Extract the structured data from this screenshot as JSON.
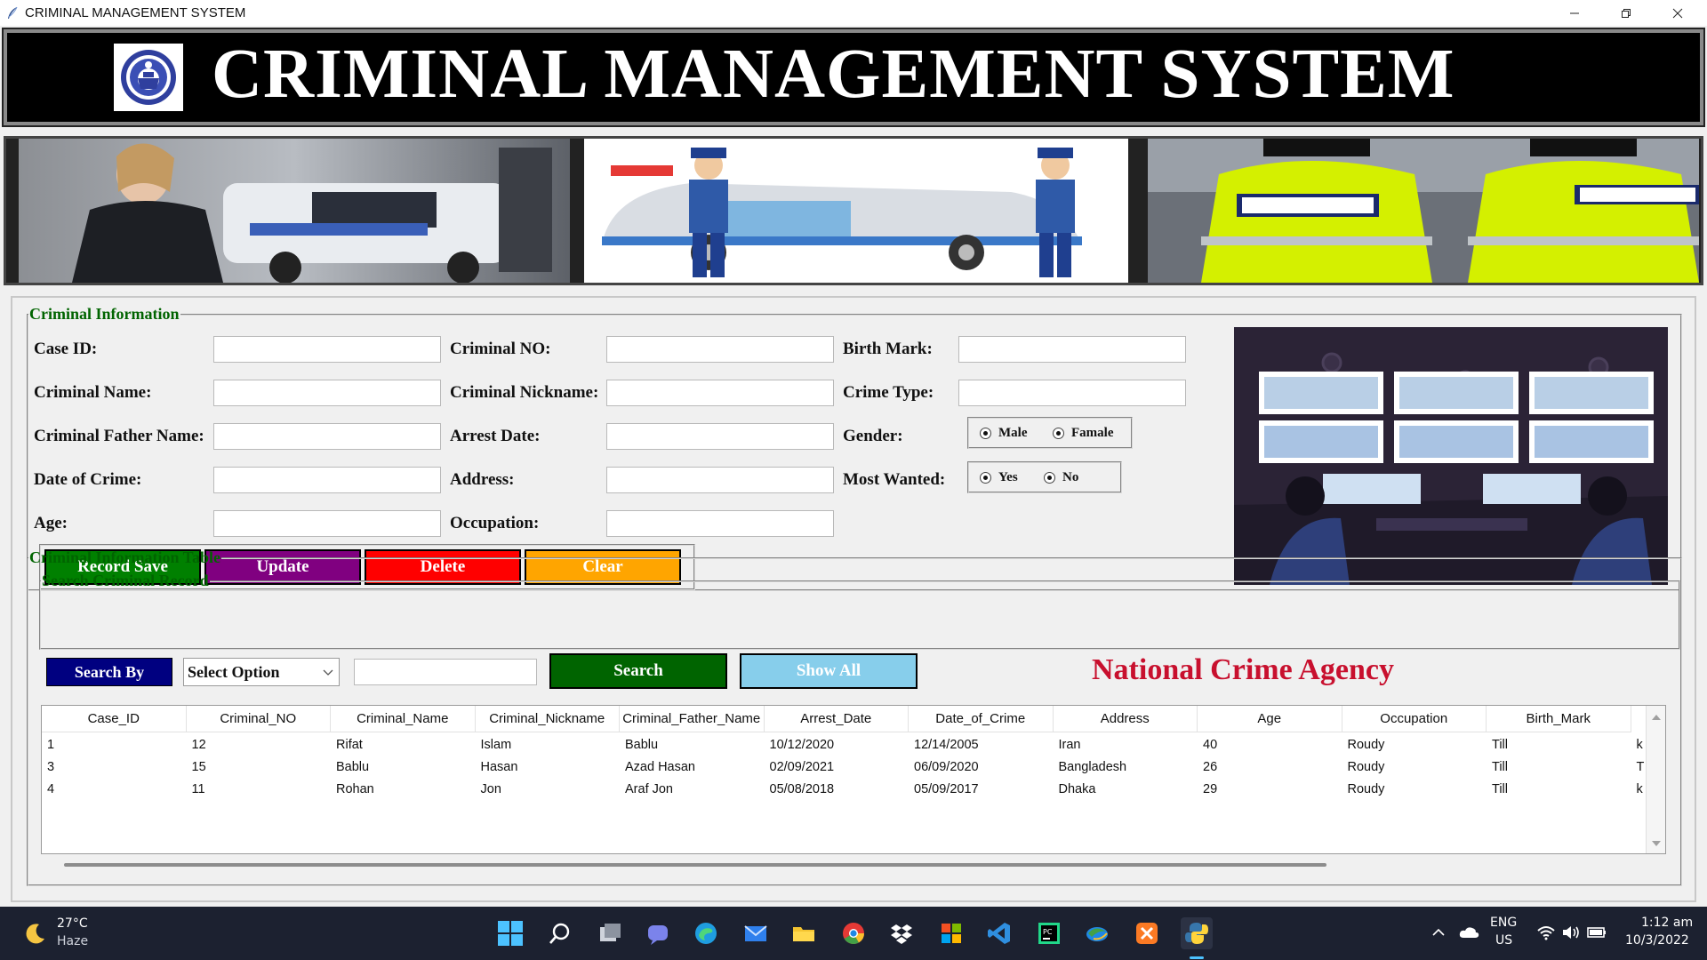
{
  "window": {
    "title": "CRIMINAL MANAGEMENT SYSTEM"
  },
  "header": {
    "title": "CRIMINAL MANAGEMENT SYSTEM"
  },
  "form": {
    "legend": "Criminal Information",
    "labels": {
      "case_id": "Case ID:",
      "criminal_no": "Criminal NO:",
      "birth_mark": "Birth Mark:",
      "criminal_name": "Criminal Name:",
      "criminal_nickname": "Criminal Nickname:",
      "crime_type": "Crime Type:",
      "father_name": "Criminal Father Name:",
      "arrest_date": "Arrest Date:",
      "gender": "Gender:",
      "date_of_crime": "Date of Crime:",
      "address": "Address:",
      "most_wanted": "Most Wanted:",
      "age": "Age:",
      "occupation": "Occupation:"
    },
    "values": {
      "case_id": "",
      "criminal_no": "",
      "birth_mark": "",
      "criminal_name": "",
      "criminal_nickname": "",
      "crime_type": "",
      "father_name": "",
      "arrest_date": "",
      "date_of_crime": "",
      "address": "",
      "age": "",
      "occupation": ""
    },
    "gender_options": [
      "Male",
      "Famale"
    ],
    "most_wanted_options": [
      "Yes",
      "No"
    ],
    "buttons": {
      "save": "Record Save",
      "update": "Update",
      "delete": "Delete",
      "clear": "Clear"
    }
  },
  "table_section": {
    "legend": "Criminal Information Table",
    "search_legend": "Search Criminal Record",
    "search_by": "Search By",
    "select_value": "Select Option",
    "search_text": "",
    "search_button": "Search",
    "show_all_button": "Show All",
    "agency": "National Crime Agency"
  },
  "table": {
    "columns": [
      "Case_ID",
      "Criminal_NO",
      "Criminal_Name",
      "Criminal_Nickname",
      "Criminal_Father_Name",
      "Arrest_Date",
      "Date_of_Crime",
      "Address",
      "Age",
      "Occupation",
      "Birth_Mark"
    ],
    "rows": [
      [
        "1",
        "12",
        "Rifat",
        "Islam",
        "Bablu",
        "10/12/2020",
        "12/14/2005",
        "Iran",
        "40",
        "Roudy",
        "Till",
        "k"
      ],
      [
        "3",
        "15",
        "Bablu",
        "Hasan",
        "Azad Hasan",
        "02/09/2021",
        "06/09/2020",
        "Bangladesh",
        "26",
        "Roudy",
        "Till",
        "T"
      ],
      [
        "4",
        "11",
        "Rohan",
        "Jon",
        "Araf Jon",
        "05/08/2018",
        "05/09/2017",
        "Dhaka",
        "29",
        "Roudy",
        "Till",
        "k"
      ]
    ]
  },
  "taskbar": {
    "weather_temp": "27°C",
    "weather_desc": "Haze",
    "lang": "ENG",
    "region": "US",
    "time": "1:12 am",
    "date": "10/3/2022"
  },
  "colors": {
    "save": "#008000",
    "update": "#800080",
    "delete": "#ff0000",
    "clear": "#ffa500",
    "search_by": "#000080",
    "search": "#006400",
    "show_all": "#87ceeb",
    "legend": "#006400",
    "agency": "#c8102e"
  }
}
